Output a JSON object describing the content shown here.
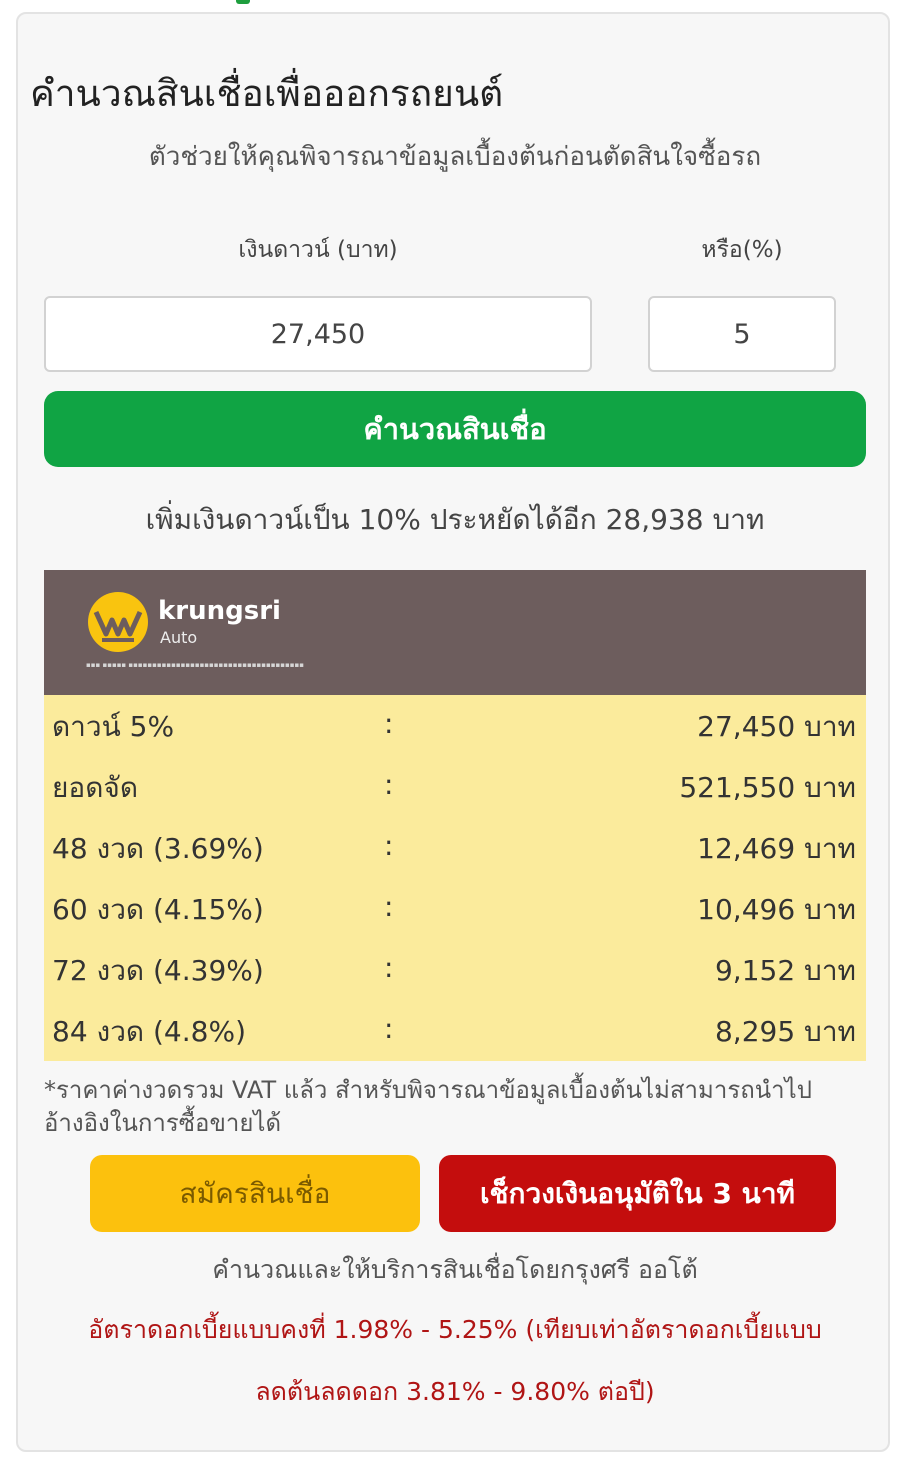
{
  "colors": {
    "accent_green": "#10a444",
    "brand_panel": "#6d5d5d",
    "result_bg": "#fbeb9c",
    "apply_button": "#fcc10d",
    "check_button": "#c40d0d",
    "rate_text": "#b01515"
  },
  "header": {
    "title": "คำนวณสินเชื่อเพื่อออกรถยนต์",
    "subtitle": "ตัวช่วยให้คุณพิจารณาข้อมูลเบื้องต้นก่อนตัดสินใจซื้อรถ"
  },
  "form": {
    "down_label": "เงินดาวน์ (บาท)",
    "down_value": "27,450",
    "percent_label": "หรือ(%)",
    "percent_value": "5",
    "calculate_label": "คำนวณสินเชื่อ"
  },
  "savings_note": "เพิ่มเงินดาวน์เป็น 10% ประหยัดได้อีก 28,938 บาท",
  "brand": {
    "name": "krungsri",
    "sub": "Auto",
    "logo_icon": "krungsri-logo-icon"
  },
  "results": [
    {
      "label": "ดาวน์ 5%",
      "sep": ":",
      "value": "27,450 บาท"
    },
    {
      "label": "ยอดจัด",
      "sep": ":",
      "value": "521,550 บาท"
    },
    {
      "label": "48 งวด (3.69%)",
      "sep": ":",
      "value": "12,469 บาท"
    },
    {
      "label": "60 งวด (4.15%)",
      "sep": ":",
      "value": "10,496 บาท"
    },
    {
      "label": "72 งวด (4.39%)",
      "sep": ":",
      "value": "9,152 บาท"
    },
    {
      "label": "84 งวด (4.8%)",
      "sep": ":",
      "value": "8,295 บาท"
    }
  ],
  "disclaimer": "*ราคาค่างวดรวม VAT แล้ว สำหรับพิจารณาข้อมูลเบื้องต้นไม่สามารถนำไปอ้างอิงในการซื้อขายได้",
  "actions": {
    "apply_label": "สมัครสินเชื่อ",
    "check_label": "เช็กวงเงินอนุมัติใน 3 นาที"
  },
  "provider_note": "คำนวณและให้บริการสินเชื่อโดยกรุงศรี ออโต้",
  "rate_note": "อัตราดอกเบี้ยแบบคงที่ 1.98% - 5.25% (เทียบเท่าอัตราดอกเบี้ยแบบลดต้นลดดอก 3.81% - 9.80% ต่อปี)"
}
